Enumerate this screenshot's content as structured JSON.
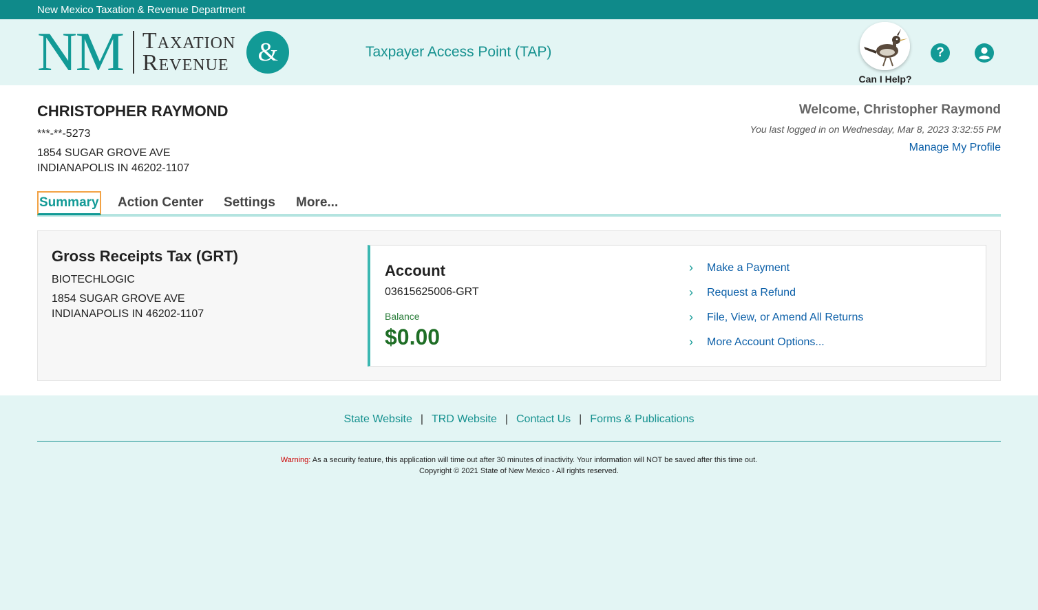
{
  "topbar": {
    "title": "New Mexico Taxation & Revenue Department"
  },
  "header": {
    "logo_nm": "NM",
    "logo_line1": "Taxation",
    "logo_line2": "Revenue",
    "logo_amp": "&",
    "app_title": "Taxpayer Access Point (TAP)",
    "help_label": "Can I Help?",
    "help_icon_glyph": "?",
    "icons": [
      "roadrunner-avatar-icon",
      "question-circle-icon",
      "user-circle-icon"
    ]
  },
  "taxpayer": {
    "name": "CHRISTOPHER RAYMOND",
    "ssn": "***-**-5273",
    "address_line1": "1854 SUGAR GROVE AVE",
    "address_line2": "INDIANAPOLIS IN 46202-1107"
  },
  "session": {
    "welcome": "Welcome, Christopher Raymond",
    "last_login": "You last logged in on Wednesday, Mar 8, 2023 3:32:55 PM",
    "manage_profile": "Manage My Profile"
  },
  "tabs": [
    {
      "label": "Summary",
      "active": true
    },
    {
      "label": "Action Center",
      "active": false
    },
    {
      "label": "Settings",
      "active": false
    },
    {
      "label": "More...",
      "active": false
    }
  ],
  "grt_card": {
    "title": "Gross Receipts Tax (GRT)",
    "business": "BIOTECHLOGIC",
    "address_line1": "1854 SUGAR GROVE AVE",
    "address_line2": "INDIANAPOLIS IN 46202-1107",
    "account": {
      "title": "Account",
      "number": "03615625006-GRT",
      "balance_label": "Balance",
      "balance_value": "$0.00"
    },
    "actions": [
      "Make a Payment",
      "Request a Refund",
      "File, View, or Amend All Returns",
      "More Account Options..."
    ]
  },
  "footer": {
    "links": [
      "State Website",
      "TRD Website",
      "Contact Us",
      "Forms & Publications"
    ],
    "separator": "|",
    "warning_label": "Warning:",
    "warning_text": "As a security feature, this application will time out after 30 minutes of inactivity. Your information will NOT be saved after this time out.",
    "copyright": "Copyright © 2021 State of New Mexico - All rights reserved."
  },
  "colors": {
    "brand_teal": "#0f8a8a",
    "header_bg": "#e3f5f4",
    "link_blue": "#0b5fa8",
    "balance_green": "#1f6e26",
    "focus_orange": "#f2a245",
    "warning_red": "#cc0000"
  }
}
